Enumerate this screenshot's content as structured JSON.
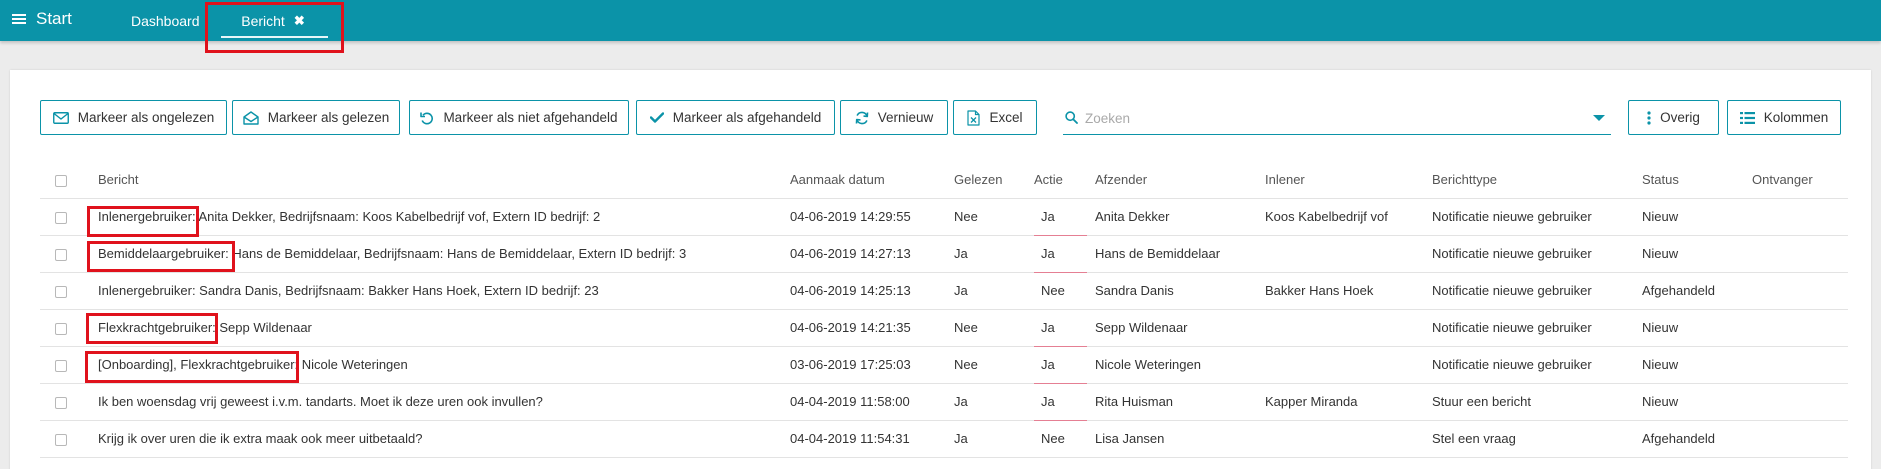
{
  "topbar": {
    "start_label": "Start",
    "tabs": [
      {
        "label": "Dashboard"
      },
      {
        "label": "Bericht",
        "close_icon": "✖"
      }
    ]
  },
  "toolbar": {
    "buttons": [
      {
        "label": "Markeer als ongelezen",
        "icon": "envelope-icon"
      },
      {
        "label": "Markeer als gelezen",
        "icon": "envelope-open-icon"
      },
      {
        "label": "Markeer als niet afgehandeld",
        "icon": "undo-icon"
      },
      {
        "label": "Markeer als afgehandeld",
        "icon": "check-icon"
      },
      {
        "label": "Vernieuw",
        "icon": "refresh-icon"
      },
      {
        "label": "Excel",
        "icon": "excel-file-icon"
      }
    ],
    "search_placeholder": "Zoeken",
    "overig_label": "Overig",
    "kolommen_label": "Kolommen"
  },
  "table": {
    "headers": {
      "bericht": "Bericht",
      "aanmaak_datum": "Aanmaak datum",
      "gelezen": "Gelezen",
      "actie": "Actie",
      "afzender": "Afzender",
      "inlener": "Inlener",
      "berichttype": "Berichttype",
      "status": "Status",
      "ontvanger": "Ontvanger"
    },
    "rows": [
      {
        "bericht": "Inlenergebruiker: Anita Dekker, Bedrijfsnaam: Koos Kabelbedrijf vof, Extern ID bedrijf: 2",
        "datum": "04-06-2019 14:29:55",
        "gelezen": "Nee",
        "actie": "Ja",
        "afzender": "Anita Dekker",
        "inlener": "Koos Kabelbedrijf vof",
        "berichttype": "Notificatie nieuwe gebruiker",
        "status": "Nieuw",
        "ontvanger": ""
      },
      {
        "bericht": "Bemiddelaargebruiker: Hans de Bemiddelaar, Bedrijfsnaam: Hans de Bemiddelaar, Extern ID bedrijf: 3",
        "datum": "04-06-2019 14:27:13",
        "gelezen": "Ja",
        "actie": "Ja",
        "afzender": "Hans de Bemiddelaar",
        "inlener": "",
        "berichttype": "Notificatie nieuwe gebruiker",
        "status": "Nieuw",
        "ontvanger": ""
      },
      {
        "bericht": "Inlenergebruiker: Sandra Danis, Bedrijfsnaam: Bakker Hans Hoek, Extern ID bedrijf: 23",
        "datum": "04-06-2019 14:25:13",
        "gelezen": "Ja",
        "actie": "Nee",
        "afzender": "Sandra Danis",
        "inlener": "Bakker Hans Hoek",
        "berichttype": "Notificatie nieuwe gebruiker",
        "status": "Afgehandeld",
        "ontvanger": ""
      },
      {
        "bericht": "Flexkrachtgebruiker: Sepp Wildenaar",
        "datum": "04-06-2019 14:21:35",
        "gelezen": "Nee",
        "actie": "Ja",
        "afzender": "Sepp Wildenaar",
        "inlener": "",
        "berichttype": "Notificatie nieuwe gebruiker",
        "status": "Nieuw",
        "ontvanger": ""
      },
      {
        "bericht": "[Onboarding], Flexkrachtgebruiker: Nicole Weteringen",
        "datum": "03-06-2019 17:25:03",
        "gelezen": "Nee",
        "actie": "Ja",
        "afzender": "Nicole Weteringen",
        "inlener": "",
        "berichttype": "Notificatie nieuwe gebruiker",
        "status": "Nieuw",
        "ontvanger": ""
      },
      {
        "bericht": "Ik ben woensdag vrij geweest i.v.m. tandarts. Moet ik deze uren ook invullen?",
        "datum": "04-04-2019 11:58:00",
        "gelezen": "Ja",
        "actie": "Ja",
        "afzender": "Rita Huisman",
        "inlener": "Kapper Miranda",
        "berichttype": "Stuur een bericht",
        "status": "Nieuw",
        "ontvanger": ""
      },
      {
        "bericht": "Krijg ik over uren die ik extra maak ook meer uitbetaald?",
        "datum": "04-04-2019 11:54:31",
        "gelezen": "Ja",
        "actie": "Nee",
        "afzender": "Lisa Jansen",
        "inlener": "",
        "berichttype": "Stel een vraag",
        "status": "Afgehandeld",
        "ontvanger": ""
      }
    ]
  },
  "colors": {
    "accent": "#0b93a8",
    "highlight_red": "#e0121c",
    "actie_underline": "#e57f93"
  }
}
